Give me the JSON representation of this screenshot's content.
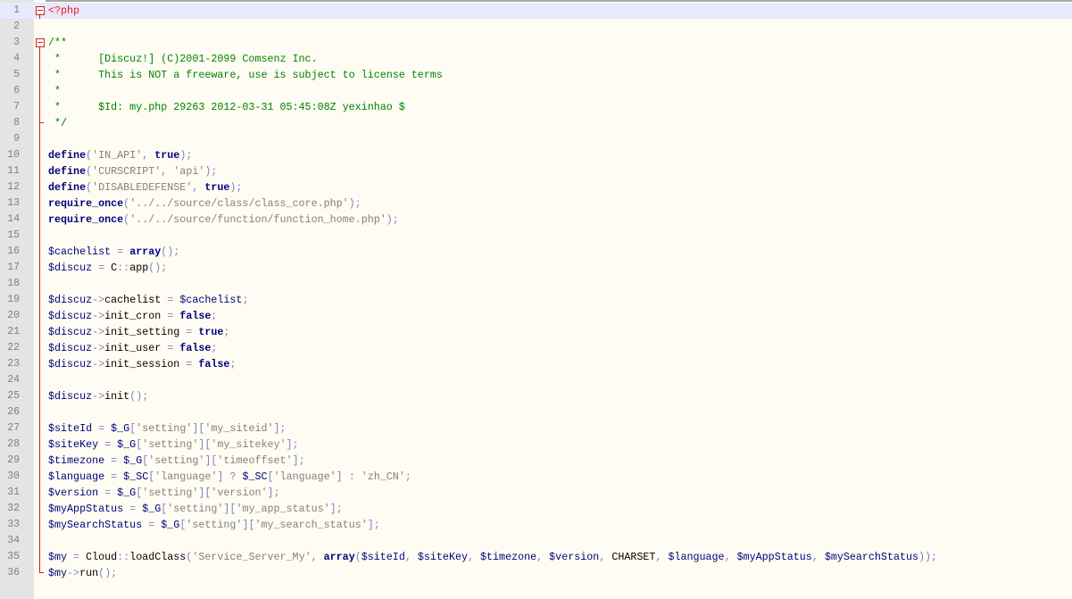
{
  "editor": {
    "language": "PHP",
    "current_line": 1,
    "colors": {
      "background": "#fffdf3",
      "gutter": "#e4e4e4",
      "current_line": "#e8e8ff",
      "php_tag": "#e02020",
      "comment": "#008000",
      "keyword": "#000080",
      "string": "#808080",
      "fold_marker": "#cc2222"
    },
    "lines": [
      {
        "n": "1",
        "fold": "start",
        "tokens": [
          {
            "c": "phptag",
            "t": "<?php"
          }
        ]
      },
      {
        "n": "2",
        "fold": "none",
        "tokens": []
      },
      {
        "n": "3",
        "fold": "start",
        "tokens": [
          {
            "c": "comment",
            "t": "/**"
          }
        ]
      },
      {
        "n": "4",
        "fold": "mid",
        "tokens": [
          {
            "c": "comment",
            "t": " *      [Discuz!] (C)2001-2099 Comsenz Inc."
          }
        ]
      },
      {
        "n": "5",
        "fold": "mid",
        "tokens": [
          {
            "c": "comment",
            "t": " *      This is NOT a freeware, use is subject to license terms"
          }
        ]
      },
      {
        "n": "6",
        "fold": "mid",
        "tokens": [
          {
            "c": "comment",
            "t": " *"
          }
        ]
      },
      {
        "n": "7",
        "fold": "mid",
        "tokens": [
          {
            "c": "comment",
            "t": " *      $Id: my.php 29263 2012-03-31 05:45:08Z yexinhao $"
          }
        ]
      },
      {
        "n": "8",
        "fold": "end",
        "tokens": [
          {
            "c": "comment",
            "t": " */"
          }
        ]
      },
      {
        "n": "9",
        "fold": "mid",
        "tokens": []
      },
      {
        "n": "10",
        "fold": "mid",
        "tokens": [
          {
            "c": "func",
            "t": "define"
          },
          {
            "c": "op",
            "t": "("
          },
          {
            "c": "str",
            "t": "'IN_API'"
          },
          {
            "c": "op",
            "t": ", "
          },
          {
            "c": "kw",
            "t": "true"
          },
          {
            "c": "op",
            "t": ");"
          }
        ]
      },
      {
        "n": "11",
        "fold": "mid",
        "tokens": [
          {
            "c": "func",
            "t": "define"
          },
          {
            "c": "op",
            "t": "("
          },
          {
            "c": "str",
            "t": "'CURSCRIPT'"
          },
          {
            "c": "op",
            "t": ", "
          },
          {
            "c": "str",
            "t": "'api'"
          },
          {
            "c": "op",
            "t": ");"
          }
        ]
      },
      {
        "n": "12",
        "fold": "mid",
        "tokens": [
          {
            "c": "func",
            "t": "define"
          },
          {
            "c": "op",
            "t": "("
          },
          {
            "c": "str",
            "t": "'DISABLEDEFENSE'"
          },
          {
            "c": "op",
            "t": ", "
          },
          {
            "c": "kw",
            "t": "true"
          },
          {
            "c": "op",
            "t": ");"
          }
        ]
      },
      {
        "n": "13",
        "fold": "mid",
        "tokens": [
          {
            "c": "func",
            "t": "require_once"
          },
          {
            "c": "op",
            "t": "("
          },
          {
            "c": "str",
            "t": "'../../source/class/class_core.php'"
          },
          {
            "c": "op",
            "t": ");"
          }
        ]
      },
      {
        "n": "14",
        "fold": "mid",
        "tokens": [
          {
            "c": "func",
            "t": "require_once"
          },
          {
            "c": "op",
            "t": "("
          },
          {
            "c": "str",
            "t": "'../../source/function/function_home.php'"
          },
          {
            "c": "op",
            "t": ");"
          }
        ]
      },
      {
        "n": "15",
        "fold": "mid",
        "tokens": []
      },
      {
        "n": "16",
        "fold": "mid",
        "tokens": [
          {
            "c": "var",
            "t": "$cachelist"
          },
          {
            "c": "op",
            "t": " = "
          },
          {
            "c": "kw",
            "t": "array"
          },
          {
            "c": "op",
            "t": "();"
          }
        ]
      },
      {
        "n": "17",
        "fold": "mid",
        "tokens": [
          {
            "c": "var",
            "t": "$discuz"
          },
          {
            "c": "op",
            "t": " = "
          },
          {
            "c": "plain",
            "t": "C"
          },
          {
            "c": "op",
            "t": "::"
          },
          {
            "c": "plain",
            "t": "app"
          },
          {
            "c": "op",
            "t": "();"
          }
        ]
      },
      {
        "n": "18",
        "fold": "mid",
        "tokens": []
      },
      {
        "n": "19",
        "fold": "mid",
        "tokens": [
          {
            "c": "var",
            "t": "$discuz"
          },
          {
            "c": "op",
            "t": "->"
          },
          {
            "c": "plain",
            "t": "cachelist"
          },
          {
            "c": "op",
            "t": " = "
          },
          {
            "c": "var",
            "t": "$cachelist"
          },
          {
            "c": "op",
            "t": ";"
          }
        ]
      },
      {
        "n": "20",
        "fold": "mid",
        "tokens": [
          {
            "c": "var",
            "t": "$discuz"
          },
          {
            "c": "op",
            "t": "->"
          },
          {
            "c": "plain",
            "t": "init_cron"
          },
          {
            "c": "op",
            "t": " = "
          },
          {
            "c": "kw",
            "t": "false"
          },
          {
            "c": "op",
            "t": ";"
          }
        ]
      },
      {
        "n": "21",
        "fold": "mid",
        "tokens": [
          {
            "c": "var",
            "t": "$discuz"
          },
          {
            "c": "op",
            "t": "->"
          },
          {
            "c": "plain",
            "t": "init_setting"
          },
          {
            "c": "op",
            "t": " = "
          },
          {
            "c": "kw",
            "t": "true"
          },
          {
            "c": "op",
            "t": ";"
          }
        ]
      },
      {
        "n": "22",
        "fold": "mid",
        "tokens": [
          {
            "c": "var",
            "t": "$discuz"
          },
          {
            "c": "op",
            "t": "->"
          },
          {
            "c": "plain",
            "t": "init_user"
          },
          {
            "c": "op",
            "t": " = "
          },
          {
            "c": "kw",
            "t": "false"
          },
          {
            "c": "op",
            "t": ";"
          }
        ]
      },
      {
        "n": "23",
        "fold": "mid",
        "tokens": [
          {
            "c": "var",
            "t": "$discuz"
          },
          {
            "c": "op",
            "t": "->"
          },
          {
            "c": "plain",
            "t": "init_session"
          },
          {
            "c": "op",
            "t": " = "
          },
          {
            "c": "kw",
            "t": "false"
          },
          {
            "c": "op",
            "t": ";"
          }
        ]
      },
      {
        "n": "24",
        "fold": "mid",
        "tokens": []
      },
      {
        "n": "25",
        "fold": "mid",
        "tokens": [
          {
            "c": "var",
            "t": "$discuz"
          },
          {
            "c": "op",
            "t": "->"
          },
          {
            "c": "plain",
            "t": "init"
          },
          {
            "c": "op",
            "t": "();"
          }
        ]
      },
      {
        "n": "26",
        "fold": "mid",
        "tokens": []
      },
      {
        "n": "27",
        "fold": "mid",
        "tokens": [
          {
            "c": "var",
            "t": "$siteId"
          },
          {
            "c": "op",
            "t": " = "
          },
          {
            "c": "var",
            "t": "$_G"
          },
          {
            "c": "op",
            "t": "["
          },
          {
            "c": "str",
            "t": "'setting'"
          },
          {
            "c": "op",
            "t": "]["
          },
          {
            "c": "str",
            "t": "'my_siteid'"
          },
          {
            "c": "op",
            "t": "];"
          }
        ]
      },
      {
        "n": "28",
        "fold": "mid",
        "tokens": [
          {
            "c": "var",
            "t": "$siteKey"
          },
          {
            "c": "op",
            "t": " = "
          },
          {
            "c": "var",
            "t": "$_G"
          },
          {
            "c": "op",
            "t": "["
          },
          {
            "c": "str",
            "t": "'setting'"
          },
          {
            "c": "op",
            "t": "]["
          },
          {
            "c": "str",
            "t": "'my_sitekey'"
          },
          {
            "c": "op",
            "t": "];"
          }
        ]
      },
      {
        "n": "29",
        "fold": "mid",
        "tokens": [
          {
            "c": "var",
            "t": "$timezone"
          },
          {
            "c": "op",
            "t": " = "
          },
          {
            "c": "var",
            "t": "$_G"
          },
          {
            "c": "op",
            "t": "["
          },
          {
            "c": "str",
            "t": "'setting'"
          },
          {
            "c": "op",
            "t": "]["
          },
          {
            "c": "str",
            "t": "'timeoffset'"
          },
          {
            "c": "op",
            "t": "];"
          }
        ]
      },
      {
        "n": "30",
        "fold": "mid",
        "tokens": [
          {
            "c": "var",
            "t": "$language"
          },
          {
            "c": "op",
            "t": " = "
          },
          {
            "c": "var",
            "t": "$_SC"
          },
          {
            "c": "op",
            "t": "["
          },
          {
            "c": "str",
            "t": "'language'"
          },
          {
            "c": "op",
            "t": "] ? "
          },
          {
            "c": "var",
            "t": "$_SC"
          },
          {
            "c": "op",
            "t": "["
          },
          {
            "c": "str",
            "t": "'language'"
          },
          {
            "c": "op",
            "t": "] : "
          },
          {
            "c": "str",
            "t": "'zh_CN'"
          },
          {
            "c": "op",
            "t": ";"
          }
        ]
      },
      {
        "n": "31",
        "fold": "mid",
        "tokens": [
          {
            "c": "var",
            "t": "$version"
          },
          {
            "c": "op",
            "t": " = "
          },
          {
            "c": "var",
            "t": "$_G"
          },
          {
            "c": "op",
            "t": "["
          },
          {
            "c": "str",
            "t": "'setting'"
          },
          {
            "c": "op",
            "t": "]["
          },
          {
            "c": "str",
            "t": "'version'"
          },
          {
            "c": "op",
            "t": "];"
          }
        ]
      },
      {
        "n": "32",
        "fold": "mid",
        "tokens": [
          {
            "c": "var",
            "t": "$myAppStatus"
          },
          {
            "c": "op",
            "t": " = "
          },
          {
            "c": "var",
            "t": "$_G"
          },
          {
            "c": "op",
            "t": "["
          },
          {
            "c": "str",
            "t": "'setting'"
          },
          {
            "c": "op",
            "t": "]["
          },
          {
            "c": "str",
            "t": "'my_app_status'"
          },
          {
            "c": "op",
            "t": "];"
          }
        ]
      },
      {
        "n": "33",
        "fold": "mid",
        "tokens": [
          {
            "c": "var",
            "t": "$mySearchStatus"
          },
          {
            "c": "op",
            "t": " = "
          },
          {
            "c": "var",
            "t": "$_G"
          },
          {
            "c": "op",
            "t": "["
          },
          {
            "c": "str",
            "t": "'setting'"
          },
          {
            "c": "op",
            "t": "]["
          },
          {
            "c": "str",
            "t": "'my_search_status'"
          },
          {
            "c": "op",
            "t": "];"
          }
        ]
      },
      {
        "n": "34",
        "fold": "mid",
        "tokens": []
      },
      {
        "n": "35",
        "fold": "mid",
        "tokens": [
          {
            "c": "var",
            "t": "$my"
          },
          {
            "c": "op",
            "t": " = "
          },
          {
            "c": "plain",
            "t": "Cloud"
          },
          {
            "c": "op",
            "t": "::"
          },
          {
            "c": "plain",
            "t": "loadClass"
          },
          {
            "c": "op",
            "t": "("
          },
          {
            "c": "str",
            "t": "'Service_Server_My'"
          },
          {
            "c": "op",
            "t": ", "
          },
          {
            "c": "kw",
            "t": "array"
          },
          {
            "c": "op",
            "t": "("
          },
          {
            "c": "var",
            "t": "$siteId"
          },
          {
            "c": "op",
            "t": ", "
          },
          {
            "c": "var",
            "t": "$siteKey"
          },
          {
            "c": "op",
            "t": ", "
          },
          {
            "c": "var",
            "t": "$timezone"
          },
          {
            "c": "op",
            "t": ", "
          },
          {
            "c": "var",
            "t": "$version"
          },
          {
            "c": "op",
            "t": ", "
          },
          {
            "c": "plain",
            "t": "CHARSET"
          },
          {
            "c": "op",
            "t": ", "
          },
          {
            "c": "var",
            "t": "$language"
          },
          {
            "c": "op",
            "t": ", "
          },
          {
            "c": "var",
            "t": "$myAppStatus"
          },
          {
            "c": "op",
            "t": ", "
          },
          {
            "c": "var",
            "t": "$mySearchStatus"
          },
          {
            "c": "op",
            "t": "));"
          }
        ]
      },
      {
        "n": "36",
        "fold": "last",
        "tokens": [
          {
            "c": "var",
            "t": "$my"
          },
          {
            "c": "op",
            "t": "->"
          },
          {
            "c": "plain",
            "t": "run"
          },
          {
            "c": "op",
            "t": "();"
          }
        ]
      }
    ]
  }
}
